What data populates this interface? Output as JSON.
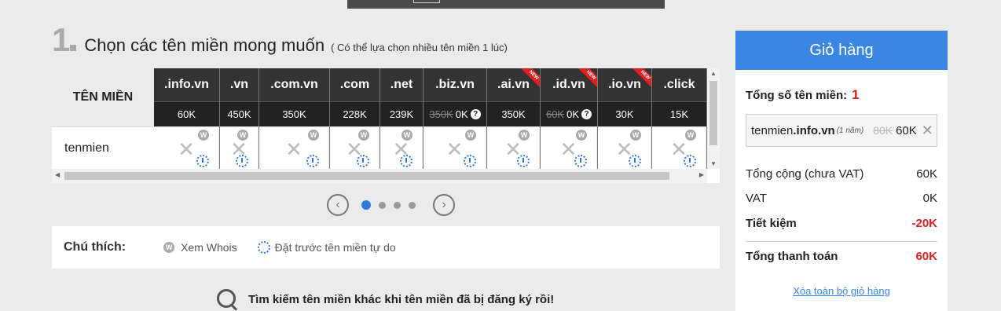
{
  "step": {
    "number": "1",
    "title": "Chọn các tên miền mong muốn",
    "note": "( Có thể lựa chọn nhiều tên miền 1 lúc)"
  },
  "table": {
    "header_label": "TÊN MIỀN",
    "row_name": "tenmien",
    "columns": [
      {
        "ext": ".info.vn",
        "price": "60K",
        "old_price": "",
        "is_new": false,
        "help": false,
        "width": 84
      },
      {
        "ext": ".vn",
        "price": "450K",
        "old_price": "",
        "is_new": false,
        "help": false,
        "width": 50
      },
      {
        "ext": ".com.vn",
        "price": "350K",
        "old_price": "",
        "is_new": false,
        "help": false,
        "width": 90
      },
      {
        "ext": ".com",
        "price": "228K",
        "old_price": "",
        "is_new": false,
        "help": false,
        "width": 64
      },
      {
        "ext": ".net",
        "price": "239K",
        "old_price": "",
        "is_new": false,
        "help": false,
        "width": 55
      },
      {
        "ext": ".biz.vn",
        "price": "0K",
        "old_price": "350K",
        "is_new": false,
        "help": true,
        "width": 81
      },
      {
        "ext": ".ai.vn",
        "price": "350K",
        "old_price": "",
        "is_new": true,
        "help": false,
        "width": 68
      },
      {
        "ext": ".id.vn",
        "price": "0K",
        "old_price": "60K",
        "is_new": true,
        "help": true,
        "width": 73
      },
      {
        "ext": ".io.vn",
        "price": "30K",
        "old_price": "",
        "is_new": true,
        "help": false,
        "width": 69
      },
      {
        "ext": ".click",
        "price": "15K",
        "old_price": "",
        "is_new": false,
        "help": false,
        "width": 70
      }
    ],
    "unavailable_mark": "✕",
    "whois_icon": "W",
    "new_label": "NEW"
  },
  "pager": {
    "prev": "‹",
    "next": "›",
    "pages": 4,
    "active": 1
  },
  "legend": {
    "title": "Chú thích:",
    "whois": "Xem Whois",
    "preorder": "Đặt trước tên miền tự do"
  },
  "search_more": "Tìm kiếm tên miền khác khi tên miền đã bị đăng ký rồi!",
  "cart": {
    "title": "Giỏ hàng",
    "count_label": "Tổng số tên miền:",
    "count": "1",
    "item": {
      "name": "tenmien",
      "ext": ".info.vn",
      "years": "(1 năm)",
      "old_price": "80K",
      "price": "60K",
      "remove": "✕"
    },
    "subtotal_label": "Tổng cộng (chưa VAT)",
    "subtotal": "60K",
    "vat_label": "VAT",
    "vat": "0K",
    "saving_label": "Tiết kiệm",
    "saving": "-20K",
    "total_label": "Tổng thanh toán",
    "total": "60K",
    "clear_label": "Xóa toàn bộ giỏ hàng"
  },
  "colors": {
    "accent": "#3a86e3",
    "danger": "#e02020",
    "header_dark": "#333333"
  }
}
